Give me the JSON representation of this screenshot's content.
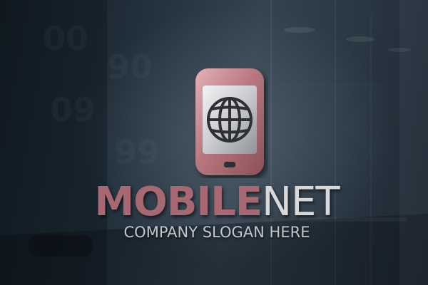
{
  "logo": {
    "icon": "smartphone-globe-icon",
    "name_part_1": "MOBILE",
    "name_part_2": "NET",
    "slogan": "COMPANY SLOGAN HERE"
  },
  "colors": {
    "background": "#22303b",
    "accent_rose": "#a86872",
    "text_light": "#d9d9dc",
    "slogan_text": "#bfc6cc"
  }
}
